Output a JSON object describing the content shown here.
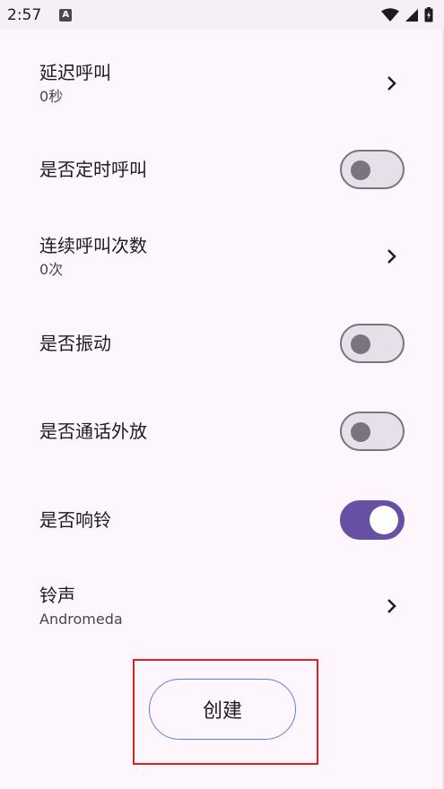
{
  "status_bar": {
    "time": "2:57",
    "notification_icon": "A",
    "icons": [
      "wifi-icon",
      "signal-icon",
      "battery-icon"
    ]
  },
  "settings": [
    {
      "title": "延迟呼叫",
      "subtitle": "0秒",
      "control": "chevron"
    },
    {
      "title": "是否定时呼叫",
      "control": "toggle",
      "on": false
    },
    {
      "title": "连续呼叫次数",
      "subtitle": "0次",
      "control": "chevron"
    },
    {
      "title": "是否振动",
      "control": "toggle",
      "on": false
    },
    {
      "title": "是否通话外放",
      "control": "toggle",
      "on": false
    },
    {
      "title": "是否响铃",
      "control": "toggle",
      "on": true
    },
    {
      "title": "铃声",
      "subtitle": "Andromeda",
      "control": "chevron"
    }
  ],
  "create_button": {
    "label": "创建"
  },
  "colors": {
    "background": "#fdf7fd",
    "accent": "#6750a4",
    "toggle_off_track": "#e6e0e9",
    "toggle_off_border": "#79747e",
    "button_border": "#5b7fe6",
    "highlight": "#e0221c"
  }
}
